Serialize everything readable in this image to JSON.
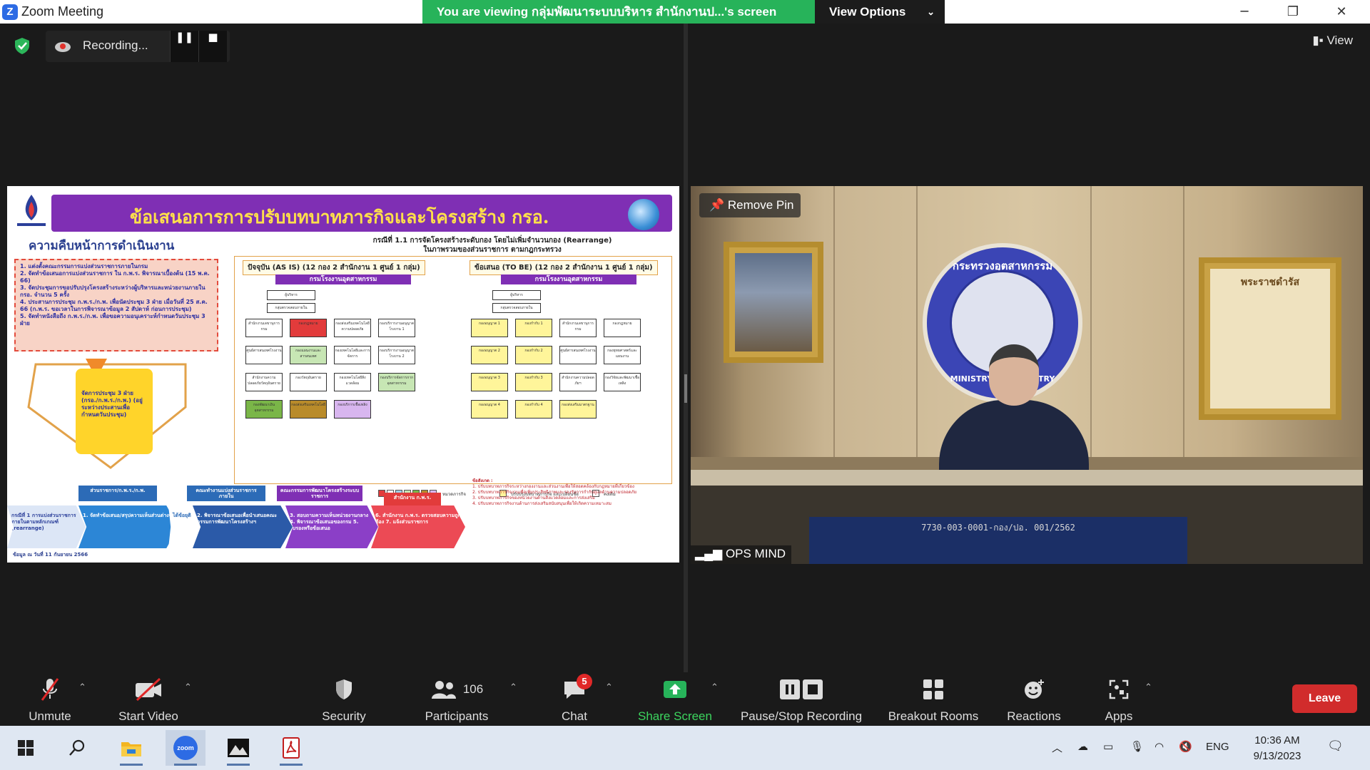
{
  "window": {
    "title": "Zoom Meeting",
    "minimize": "─",
    "restore": "❐",
    "close": "✕"
  },
  "share_banner": {
    "text": "You are viewing กลุ่มพัฒนาระบบบริหาร สำนักงานป...'s screen",
    "view_options": "View Options"
  },
  "recording": {
    "label": "Recording...",
    "pause": "❚❚",
    "stop": "■"
  },
  "view_button": "View",
  "slide": {
    "title": "ข้อเสนอการการปรับบทบาทภารกิจและโครงสร้าง กรอ.",
    "progress_title": "ความคืบหน้าการดำเนินงาน",
    "case_line1": "กรณีที่ 1.1 การจัดโครงสร้างระดับกอง โดยไม่เพิ่มจำนวนกอง (Rearrange)",
    "case_line2": "ในภาพรวมของส่วนราชการ ตามกฎกระทรวง",
    "notes": [
      "1. แต่งตั้งคณะกรรมการแบ่งส่วนราชการภายในกรม",
      "2. จัดทำข้อเสนอการแบ่งส่วนราชการ ใน ก.พ.ร. พิจารณาเบื้องต้น (15 พ.ค. 66)",
      "3. จัดประชุมการขอปรับปรุงโครงสร้างระหว่างผู้บริหารและหน่วยงานภายใน กรอ. จำนวน 5 ครั้ง",
      "4. ประสานการประชุม ก.พ.ร./ก.พ. เพื่อนัดประชุม 3 ฝ่าย เมื่อวันที่ 25 ส.ค. 66 (ก.พ.ร. ขอเวลาในการพิจารณาข้อมูล 2 สัปดาห์ ก่อนการประชุม)",
      "5. จัดทำหนังสือถึง ก.พ.ร./ก.พ. เพื่อขอความอนุเคราะห์กำหนดวันประชุม 3 ฝ่าย"
    ],
    "yellow_card": "จัดการประชุม 3 ฝ่าย (กรอ./ก.พ.ร./ก.พ.) (อยู่ระหว่างประสานเพื่อกำหนดวันประชุม)",
    "as_is_label": "ปัจจุบัน (AS IS) (12 กอง 2 สำนักงาน 1 ศูนย์ 1 กลุ่ม)",
    "to_be_label": "ข้อเสนอ (TO BE) (12 กอง 2 สำนักงาน 1 ศูนย์ 1 กลุ่ม)",
    "dept_name": "กรมโรงงานอุตสาหกรรม",
    "legend_task": "หมวดภารกิจ",
    "legend_adjust": "ปรับปรุงบทบาทภารกิจ และเปลี่ยนชื่อ",
    "legend_same": "คงเดิม",
    "stages": [
      "กรณีที่ 1 การแบ่งส่วนราชการภายในตามหลักเกณฑ์ (rearrange)",
      "1. จัดทำข้อเสนอ/สรุปความเห็นส่วนต่างๆ",
      "2. พิจารณาข้อเสนอเพื่อนำเสนอคณะกรรมการพัฒนาโครงสร้างฯ",
      "3. สอบถามความเห็นหน่วยงานกลาง 4. พิจารณาข้อเสนอของกรม 5. รับรองหรือข้อเสนอ",
      "6. สำนักงาน ก.พ.ร. ตรวจสอบความถูกต้อง 7. แจ้งส่วนราชการ"
    ],
    "stage_heads": [
      "ส่วนราชการ/ก.พ.ร./ก.พ.",
      "คณะทำงานแบ่งส่วนราชการภายใน",
      "คณะกรรมการพัฒนาโครงสร้างระบบราชการ",
      "สำนักงาน ก.พ.ร."
    ],
    "approved_label": "ได้ข้อยุติ",
    "remarks_title": "ข้อสังเกต :",
    "remarks": [
      "1. ปรับบทบาทภารกิจระหว่างกองงานและส่วนงานเพื่อให้สอดคล้องกับกฎหมายที่เกี่ยวข้อง",
      "2. ปรับบทบาทภารกิจงานเพื่อเพิ่มประสิทธิภาพและรองรับการกำกับดูแลด้านความปลอดภัย",
      "3. ปรับบทบาทภารกิจของหน่วยงานด้านสิ่งแวดล้อมและการส่งเสริม",
      "4. ปรับบทบาทภารกิจงานด้านการส่งเสริมสนับสนุนเพื่อให้เกิดความเหมาะสม"
    ],
    "source": "ข้อมูล ณ วันที่ 11 กันยายน 2566",
    "org_as_is": [
      "ผู้บริหาร",
      "กลุ่มตรวจสอบภายใน",
      "สำนักงานเลขานุการกรม",
      "กองกฎหมาย",
      "กองส่งเสริมเทคโนโลยีความปลอดภัย",
      "กองบริการงานอนุญาตโรงงาน 1",
      "ศูนย์สารสนเทศโรงงาน",
      "กองแผนงานและสารสนเทศ",
      "กองเทคโนโลยีและการจัดการ",
      "กองบริการงานอนุญาตโรงงาน 2",
      "สำนักงานความปลอดภัยวัตถุอันตราย",
      "กองวัตถุอันตราย",
      "กองเทคโนโลยีสิ่งแวดล้อม",
      "กองบริการจัดการกากอุตสาหกรรม",
      "กองพัฒนาเงิน อุตสาหกรรม",
      "กองส่งเสริมเทคโนโลยี",
      "กองบริการเชื้อเพลิง"
    ],
    "org_to_be": [
      "ผู้บริหาร",
      "กลุ่มตรวจสอบภายใน",
      "กองอนุญาต 1",
      "กองกำกับ 1",
      "สำนักงานเลขานุการกรม",
      "กองกฎหมาย",
      "กองอนุญาต 2",
      "กองกำกับ 2",
      "ศูนย์สารสนเทศโรงงาน",
      "กองยุทธศาสตร์และแผนงาน",
      "กองอนุญาต 3",
      "กองกำกับ 3",
      "สำนักงานความปลอดภัยฯ",
      "กองวิจัยและพัฒนาเชื้อเพลิง",
      "กองอนุญาต 4",
      "กองกำกับ 4",
      "กองส่งเสริมมาตรฐาน"
    ]
  },
  "video": {
    "remove_pin": "Remove Pin",
    "participant_name": "OPS MIND",
    "emblem_top": "กระทรวงอุตสาหกรรม",
    "emblem_bottom": "MINISTRY OF INDUSTRY",
    "certificate_title": "พระราชดำรัส",
    "table_plate": "7730-003-0001-กอง/ปอ. 001/2562"
  },
  "toolbar": {
    "unmute": "Unmute",
    "start_video": "Start Video",
    "security": "Security",
    "participants": "Participants",
    "participant_count": "106",
    "chat": "Chat",
    "chat_badge": "5",
    "share_screen": "Share Screen",
    "pause_stop_recording": "Pause/Stop Recording",
    "breakout_rooms": "Breakout Rooms",
    "reactions": "Reactions",
    "apps": "Apps",
    "leave": "Leave"
  },
  "taskbar": {
    "language": "ENG",
    "time": "10:36 AM",
    "date": "9/13/2023",
    "zoom_label": "zoom"
  },
  "colors": {
    "banner_green": "#27b35a",
    "leave_red": "#d12c2c",
    "share_green": "#3cd45e",
    "slide_purple": "#7f2fb4"
  }
}
